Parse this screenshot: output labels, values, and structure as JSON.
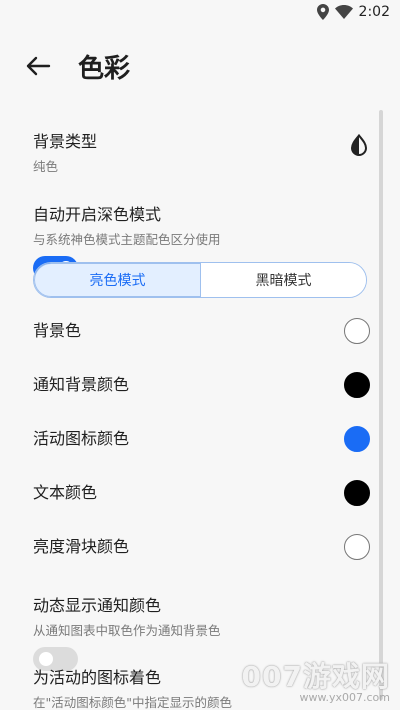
{
  "status": {
    "time": "2:02"
  },
  "header": {
    "title": "色彩"
  },
  "settings": {
    "bg_type": {
      "title": "背景类型",
      "subtitle": "纯色"
    },
    "auto_dark": {
      "title": "自动开启深色模式",
      "subtitle": "与系统神色模式主题配色区分使用",
      "enabled": true
    },
    "mode_tabs": [
      {
        "label": "亮色模式",
        "selected": true
      },
      {
        "label": "黑暗模式",
        "selected": false
      }
    ],
    "bg_color": {
      "title": "背景色",
      "color": "#ffffff"
    },
    "notif_bg_color": {
      "title": "通知背景颜色",
      "color": "#000000"
    },
    "active_icon_color": {
      "title": "活动图标颜色",
      "color": "#1a6cf5"
    },
    "text_color": {
      "title": "文本颜色",
      "color": "#000000"
    },
    "brightness_color": {
      "title": "亮度滑块颜色",
      "color": "#ffffff"
    },
    "dynamic_notif": {
      "title": "动态显示通知颜色",
      "subtitle": "从通知图表中取色作为通知背景色",
      "enabled": false
    },
    "tint_active": {
      "title": "为活动的图标着色",
      "subtitle": "在\"活动图标颜色\"中指定显示的颜色"
    }
  },
  "colors": {
    "accent": "#1a6cf5",
    "toggle_off": "#dcdcdc",
    "seg_selected_bg": "#e3efff",
    "seg_border": "#9fc0ee"
  },
  "watermark": {
    "main": "007游戏网",
    "sub": "www.yx007.com"
  }
}
